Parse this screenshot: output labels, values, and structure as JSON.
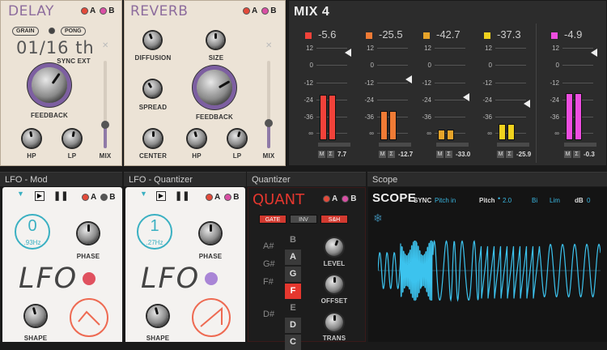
{
  "delay": {
    "title": "DELAY",
    "a": "A",
    "b": "B",
    "grain": "GRAIN",
    "pong": "PONG",
    "time": "01/16 th",
    "sync": "SYNC EXT",
    "feedback": "FEEDBACK",
    "hp": "HP",
    "lp": "LP",
    "mix": "MIX"
  },
  "reverb": {
    "title": "REVERB",
    "a": "A",
    "b": "B",
    "diffusion": "DIFFUSION",
    "size": "SIZE",
    "spread": "SPREAD",
    "feedback": "FEEDBACK",
    "center": "CENTER",
    "hp": "HP",
    "lp": "LP",
    "mix": "MIX"
  },
  "mix": {
    "title": "MIX 4",
    "scale": [
      "12",
      "0",
      "-12",
      "-24",
      "-36",
      "∞"
    ],
    "channels": [
      {
        "peak": "-5.6",
        "value": "7.7",
        "color": "#f2423a",
        "m": "M",
        "s": "Σ",
        "level": 0.6
      },
      {
        "peak": "-25.5",
        "value": "-12.7",
        "color": "#ef7b35",
        "m": "M",
        "s": "Σ",
        "level": 0.39
      },
      {
        "peak": "-42.7",
        "value": "-33.0",
        "color": "#e7a42a",
        "m": "M",
        "s": "Σ",
        "level": 0.14
      },
      {
        "peak": "-37.3",
        "value": "-25.9",
        "color": "#f0d21e",
        "m": "M",
        "s": "Σ",
        "level": 0.21
      },
      {
        "peak": "-4.9",
        "value": "-0.3",
        "color": "#ee4ee0",
        "m": "M",
        "s": "Σ",
        "level": 0.62
      }
    ]
  },
  "tabs": {
    "lfo_mod": "LFO - Mod",
    "lfo_quant": "LFO - Quantizer",
    "quantizer": "Quantizer",
    "scope": "Scope"
  },
  "lfo1": {
    "a": "A",
    "b": "B",
    "rate": "0",
    "freq": ".93Hz",
    "phase": "PHASE",
    "logo": "LFO",
    "shape": "SHAPE",
    "dot_color": "#e0515f"
  },
  "lfo2": {
    "a": "A",
    "b": "B",
    "rate": "1",
    "freq": ".27Hz",
    "phase": "PHASE",
    "logo": "LFO",
    "shape": "SHAPE",
    "dot_color": "#a985d6"
  },
  "quant": {
    "title": "QUANT",
    "a": "A",
    "b": "B",
    "gate": "GATE",
    "inv": "INV",
    "sh": "S&H",
    "sharps": [
      "A#",
      "G#",
      "F#",
      "D#"
    ],
    "notes": [
      "B",
      "A",
      "G",
      "F",
      "E",
      "D",
      "C"
    ],
    "level": "LEVEL",
    "offset": "OFFSET",
    "trans": "TRANS"
  },
  "scope": {
    "title": "SCOPE",
    "sync": "SYNC",
    "sync_src": "Pitch in",
    "pitch": "Pitch",
    "pitch_val": "2.0",
    "bi": "Bi",
    "lim": "Lim",
    "db": "dB",
    "db_val": "0"
  }
}
